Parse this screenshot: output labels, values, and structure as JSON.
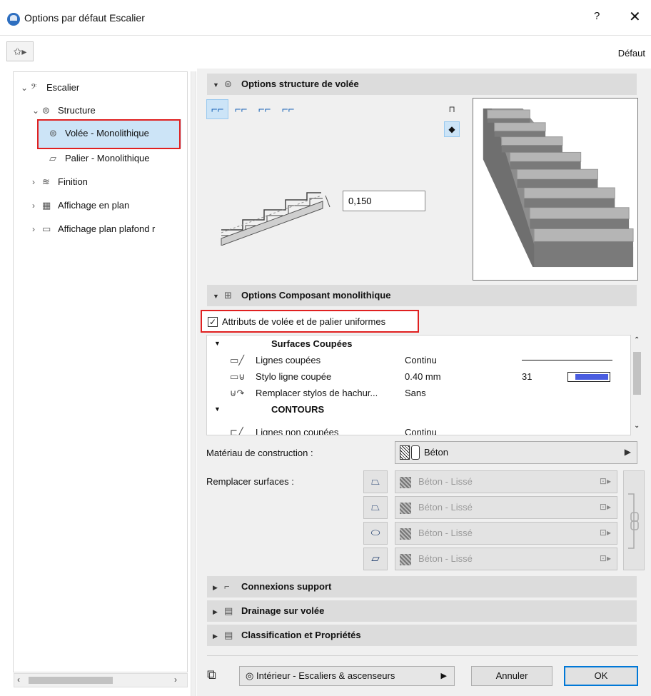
{
  "window": {
    "title": "Options par défaut Escalier",
    "help": "?",
    "close": "✕"
  },
  "toolbar": {
    "favorites_icon": "favorites-icon",
    "default_label": "Défaut"
  },
  "tree": {
    "items": [
      {
        "label": "Escalier",
        "icon": "stair-icon"
      },
      {
        "label": "Structure",
        "icon": "structure-icon"
      },
      {
        "label": "Volée - Monolithique",
        "icon": "flight-icon",
        "selected": true
      },
      {
        "label": "Palier - Monolithique",
        "icon": "landing-icon"
      },
      {
        "label": "Finition",
        "icon": "finish-icon"
      },
      {
        "label": "Affichage en plan",
        "icon": "plan-display-icon"
      },
      {
        "label": "Affichage plan plafond r",
        "icon": "ceiling-plan-icon"
      }
    ]
  },
  "sections": {
    "structure_title": "Options structure de volée",
    "component_title": "Options Composant monolithique",
    "support_title": "Connexions support",
    "drainage_title": "Drainage sur volée",
    "classification_title": "Classification et Propriétés"
  },
  "structure": {
    "thickness_value": "0,150"
  },
  "component": {
    "uniform_label": "Attributs de volée et de palier uniformes",
    "uniform_checked": true,
    "groups": {
      "cut_surfaces": "Surfaces Coupées",
      "contours": "CONTOURS"
    },
    "rows": [
      {
        "label": "Lignes coupées",
        "value": "Continu",
        "num": ""
      },
      {
        "label": "Stylo ligne coupée",
        "value": "0.40 mm",
        "num": "31"
      },
      {
        "label": "Remplacer stylos de hachur...",
        "value": "Sans",
        "num": ""
      },
      {
        "label": "Lignes non coupées",
        "value": "Continu",
        "num": ""
      }
    ],
    "material_label": "Matériau de construction :",
    "material_value": "Béton",
    "override_label": "Remplacer surfaces :",
    "surfaces": [
      "Béton - Lissé",
      "Béton - Lissé",
      "Béton - Lissé",
      "Béton - Lissé"
    ]
  },
  "footer": {
    "layer": "Intérieur - Escaliers & ascenseurs",
    "cancel": "Annuler",
    "ok": "OK"
  },
  "colors": {
    "selection": "#cce4f7",
    "highlight_box": "#e02020",
    "pen_blue": "#4a5de0"
  }
}
